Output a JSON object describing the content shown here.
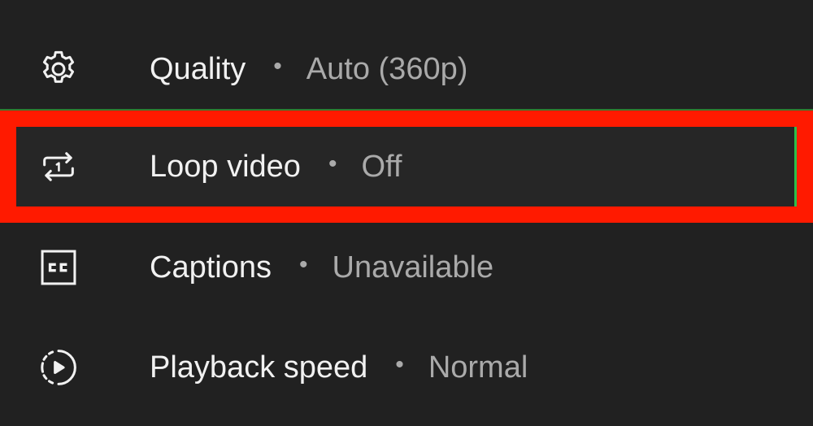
{
  "settings_menu": {
    "items": [
      {
        "label": "Quality",
        "separator": "•",
        "value": "Auto (360p)",
        "icon": "gear-icon"
      },
      {
        "label": "Loop video",
        "separator": "•",
        "value": "Off",
        "icon": "loop-one-icon"
      },
      {
        "label": "Captions",
        "separator": "•",
        "value": "Unavailable",
        "icon": "closed-captions-icon"
      },
      {
        "label": "Playback speed",
        "separator": "•",
        "value": "Normal",
        "icon": "playback-speed-icon"
      }
    ]
  },
  "colors": {
    "background": "#212121",
    "label": "#f1f1f1",
    "value": "#aaaaaa",
    "highlight_border": "#ff1a00"
  }
}
